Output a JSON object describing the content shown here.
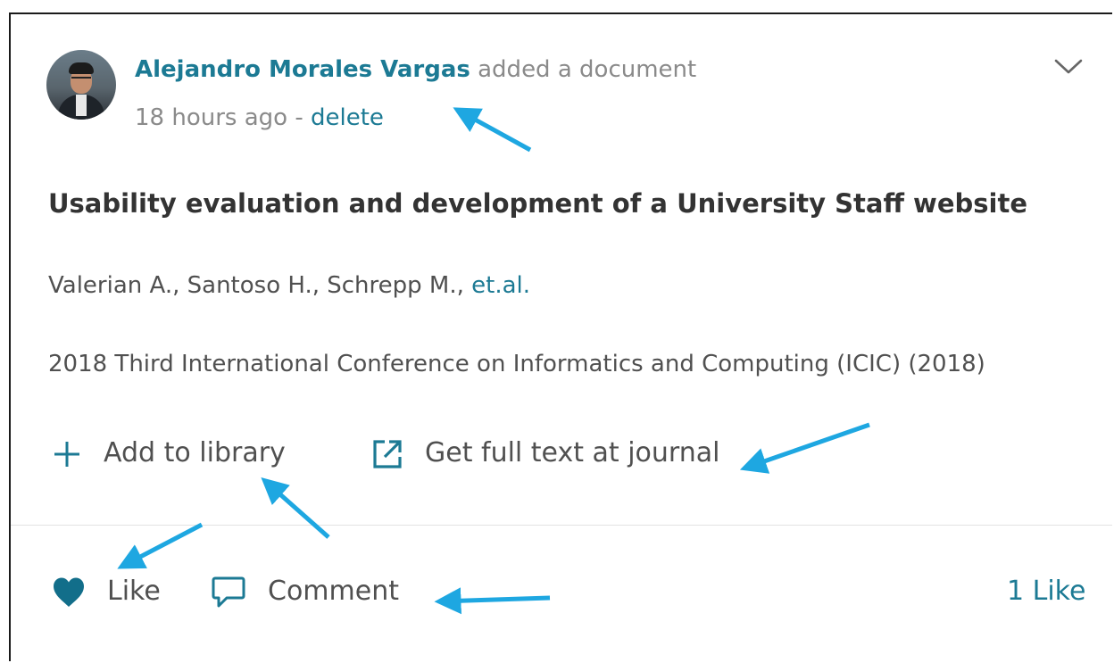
{
  "post": {
    "author_name": "Alejandro Morales Vargas",
    "action_text": "added a document",
    "time_ago": "18 hours ago",
    "separator": " - ",
    "delete_label": "delete",
    "menu_icon": "chevron-down-icon"
  },
  "document": {
    "title": "Usability evaluation and development of a University Staff website",
    "authors": "Valerian A., Santoso H., Schrepp M., ",
    "etal": "et.al.",
    "venue": "2018 Third International Conference on Informatics and Computing (ICIC) (2018)"
  },
  "actions": {
    "add_to_library": "Add to library",
    "add_icon": "plus-icon",
    "full_text": "Get full text at journal",
    "full_text_icon": "external-link-icon"
  },
  "footer": {
    "like_label": "Like",
    "like_icon": "heart-icon",
    "comment_label": "Comment",
    "comment_icon": "speech-bubble-icon",
    "like_count": "1 Like"
  },
  "colors": {
    "accent": "#1c7a94",
    "annotation_arrow": "#1ea7e1",
    "text_primary": "#333333",
    "text_secondary": "#505050",
    "text_muted": "#8a8a8a"
  }
}
